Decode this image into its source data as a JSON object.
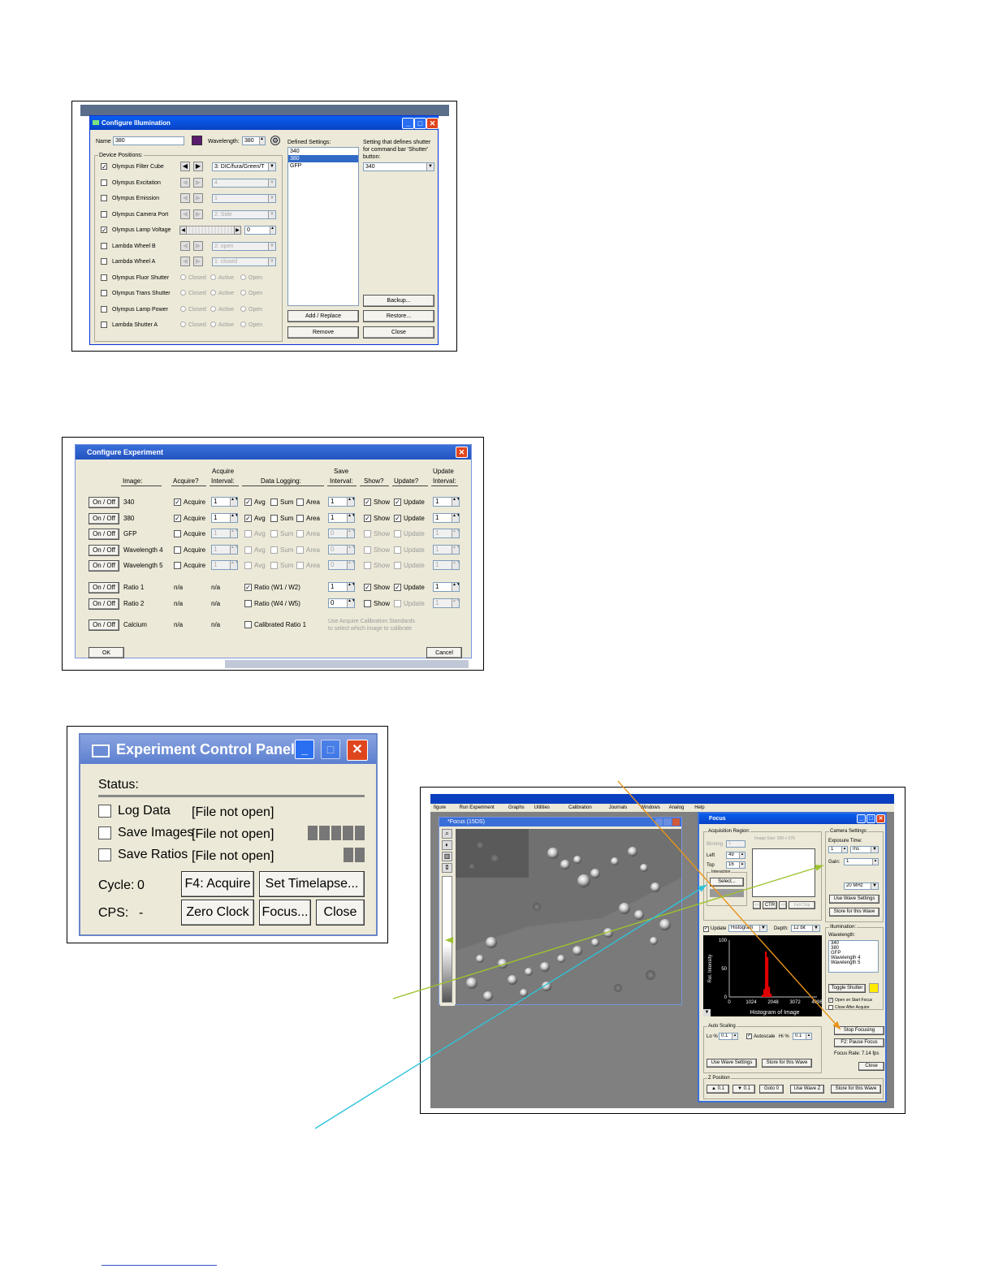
{
  "illum": {
    "title": "Configure Illumination",
    "name_label": "Name",
    "name_value": "380",
    "wavelength_label": "Wavelength:",
    "wavelength_value": "380",
    "device_positions_label": "Device Positions:",
    "devices": [
      {
        "label": "Olympus Filter Cube",
        "checked": true,
        "control": "DIC/fura/Green/T"
      },
      {
        "label": "Olympus Excitation",
        "checked": false,
        "control": "4"
      },
      {
        "label": "Olympus Emission",
        "checked": false,
        "control": "1"
      },
      {
        "label": "Olympus Camera Port",
        "checked": false,
        "control": "2: Side"
      },
      {
        "label": "Olympus Lamp Voltage",
        "checked": true,
        "control": "0"
      },
      {
        "label": "Lambda Wheel B",
        "checked": false,
        "control": "2: open"
      },
      {
        "label": "Lambda Wheel A",
        "checked": false,
        "control": "1: closed"
      },
      {
        "label": "Olympus Fluor Shutter",
        "checked": false
      },
      {
        "label": "Olympus Trans Shutter",
        "checked": false
      },
      {
        "label": "Olympus Lamp Power",
        "checked": false
      },
      {
        "label": "Lambda Shutter A",
        "checked": false
      }
    ],
    "filter_cube_value": "3: DIC/fura/Green/T",
    "radio_labels": [
      "Closed",
      "Active",
      "Open"
    ],
    "defined_settings_label": "Defined Settings:",
    "defined_settings": [
      "340",
      "380",
      "GFP"
    ],
    "selected_setting": "380",
    "shutter_label_1": "Setting that defines shutter",
    "shutter_label_2": "for command bar 'Shutter'",
    "shutter_label_3": "button:",
    "shutter_value": "340",
    "buttons": {
      "backup": "Backup...",
      "add_replace": "Add / Replace",
      "restore": "Restore...",
      "remove": "Remove",
      "close": "Close"
    }
  },
  "exp": {
    "title": "Configure Experiment",
    "headers": {
      "image": "Image:",
      "acquire": "Acquire?",
      "acq_interval_1": "Acquire",
      "acq_interval_2": "Interval:",
      "logging": "Data Logging:",
      "save_1": "Save",
      "save_2": "Interval:",
      "show": "Show?",
      "update": "Update?",
      "upd_1": "Update",
      "upd_2": "Interval:"
    },
    "onoff_label": "On / Off",
    "rows": [
      {
        "name": "340",
        "acquire": "Acquire",
        "interval": "1",
        "save": "1",
        "upd_interval": "1",
        "enabled": true
      },
      {
        "name": "380",
        "acquire": "Acquire",
        "interval": "1",
        "save": "1",
        "upd_interval": "1",
        "enabled": true
      },
      {
        "name": "GFP",
        "acquire": "Acquire",
        "interval": "1",
        "save": "0",
        "upd_interval": "1",
        "enabled": false
      },
      {
        "name": "Wavelength 4",
        "acquire": "Acquire",
        "interval": "1",
        "save": "0",
        "upd_interval": "1",
        "enabled": false
      },
      {
        "name": "Wavelength 5",
        "acquire": "Acquire",
        "interval": "1",
        "save": "0",
        "upd_interval": "1",
        "enabled": false
      }
    ],
    "log_labels": {
      "avg": "Avg",
      "sum": "Sum",
      "area": "Area",
      "show": "Show",
      "update": "Update"
    },
    "ratios": [
      {
        "name": "Ratio 1",
        "acq": "n/a",
        "interval": "n/a",
        "label": "Ratio (W1 / W2)",
        "save": "1",
        "upd_interval": "1",
        "enabled": true
      },
      {
        "name": "Ratio 2",
        "acq": "n/a",
        "interval": "n/a",
        "label": "Ratio (W4 / W5)",
        "save": "0",
        "upd_interval": "1",
        "enabled": false
      }
    ],
    "calcium": {
      "name": "Calcium",
      "acq": "n/a",
      "interval": "n/a",
      "label": "Calibrated Ratio 1",
      "hint_1": "Use Acquire Calibration Standards",
      "hint_2": "to select which image to calibrate"
    },
    "ok": "OK",
    "cancel": "Cancel"
  },
  "ecp": {
    "title": "Experiment Control Panel",
    "status": "Status:",
    "log_data": "Log Data",
    "save_images": "Save Images",
    "save_ratios": "Save Ratios",
    "file_not_open": "[File not open]",
    "cycle_label": "Cycle:",
    "cycle_value": "0",
    "cps_label": "CPS:",
    "cps_value": "-",
    "buttons": {
      "acquire": "F4: Acquire",
      "timelapse": "Set Timelapse...",
      "zero": "Zero Clock",
      "focus": "Focus...",
      "close": "Close"
    }
  },
  "app": {
    "menu": [
      "figure",
      "Run Experiment",
      "Graphs",
      "Utilities",
      "Calibration",
      "Journals",
      "Windows",
      "Analog",
      "Help"
    ],
    "image_title": "*Focus (15DS)",
    "focus_title": "Focus",
    "acq": {
      "group": "Acquisition Region:",
      "binning": "Binning",
      "binning_value": "1",
      "image_size": "Image Size: 300 x 376",
      "left": "Left",
      "left_value": "49",
      "top": "Top",
      "top_value": "16",
      "interaction": "Interaction",
      "select": "Select...",
      "ctr": "CTR",
      "full": "Full Chip"
    },
    "camera": {
      "group": "Camera Settings:",
      "exposure": "Exposure Time:",
      "exposure_value": "1",
      "unit": "ms",
      "gain": "Gain:",
      "gain_value": "1",
      "speed": "20 MHz",
      "use_wave": "Use Wave Settings",
      "store": "Store for this Wave"
    },
    "hist": {
      "update": "Update",
      "mode": "Histogram",
      "depth": "Depth:",
      "depth_value": "12 bit",
      "ylabel": "Rel. Intensity",
      "xlabel": "Histogram of Image",
      "xticks": [
        "0",
        "1024",
        "2048",
        "3072",
        "4096"
      ],
      "yticks": [
        "100",
        "50",
        "0"
      ]
    },
    "illum": {
      "group": "Illumination:",
      "wavelength": "Wavelength:",
      "items": [
        "340",
        "380",
        "GFP",
        "Wavelength 4",
        "Wavelength 5"
      ],
      "toggle": "Toggle Shutter",
      "open_on": "Open on Start Focus",
      "close_after": "Close After Acquire"
    },
    "autoscale": {
      "group": "Auto Scaling",
      "lo": "Lo %",
      "lo_value": "0.1",
      "auto": "Autoscale",
      "hi": "Hi %",
      "hi_value": "0.1",
      "use_wave": "Use Wave Settings",
      "store": "Store for this Wave"
    },
    "controls": {
      "stop": "Stop Focusing",
      "pause": "F2: Pause Focus",
      "rate": "Focus Rate: 7.14 fps",
      "close": "Close"
    },
    "zpos": {
      "group": "Z Position",
      "up": "0.1",
      "down": "0.1",
      "goto": "Goto 0",
      "use_wave": "Use Wave Z",
      "store": "Store for this Wave"
    }
  },
  "colors": {
    "arrow_orange": "#e8941a",
    "arrow_green": "#9cc22e",
    "arrow_cyan": "#2fc3d8",
    "xp_blue": "#0a5ff0"
  }
}
